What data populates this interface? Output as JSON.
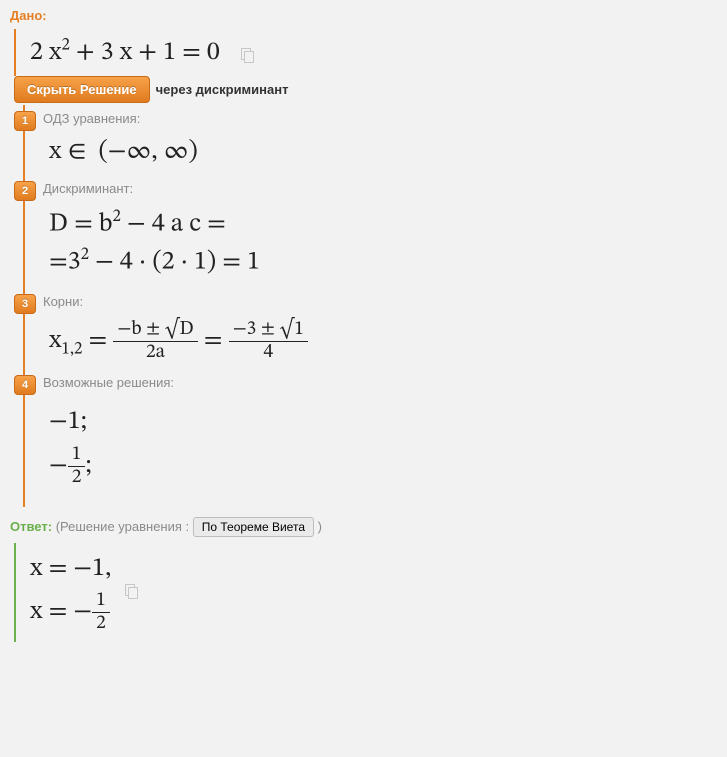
{
  "given": {
    "heading": "Дано:",
    "equation_html": "2 x<span class='sup'>2</span> + 3 x + 1 = 0"
  },
  "solution_toggle": {
    "button": "Скрыть Решение",
    "method": "через дискриминант"
  },
  "steps": [
    {
      "num": "1",
      "label": "ОДЗ уравнения:",
      "math_html": "x ∈ &nbsp;(−∞, ∞)"
    },
    {
      "num": "2",
      "label": "Дискриминант:",
      "math_html": "D = b<span class='sup'>2</span> − 4 a c =<br>=3<span class='sup'>2</span> − 4 · (2 · 1) = 1"
    },
    {
      "num": "3",
      "label": "Корни:",
      "math_html": "x<span class='sub'>1,2</span> = <span class='frac small-frac'><span class='num'>−b ± <span class='sqrt-sym'>√</span>D</span><span class='den'>2a</span></span> = <span class='frac small-frac'><span class='num'>−3 ± <span class='sqrt-sym'>√</span>1</span><span class='den'>4</span></span>"
    },
    {
      "num": "4",
      "label": "Возможные решения:",
      "math_html": "−1;<br>−<span class='frac small-frac'><span class='num'>1</span><span class='den'>2</span></span>;"
    }
  ],
  "answer": {
    "heading": "Ответ:",
    "note_prefix": "(Решение уравнения : ",
    "alt_button": "По Теореме Виета",
    "note_suffix": " )",
    "math_html": "x = −1,<br>x = −<span class='frac small-frac'><span class='num'>1</span><span class='den'>2</span></span>"
  }
}
